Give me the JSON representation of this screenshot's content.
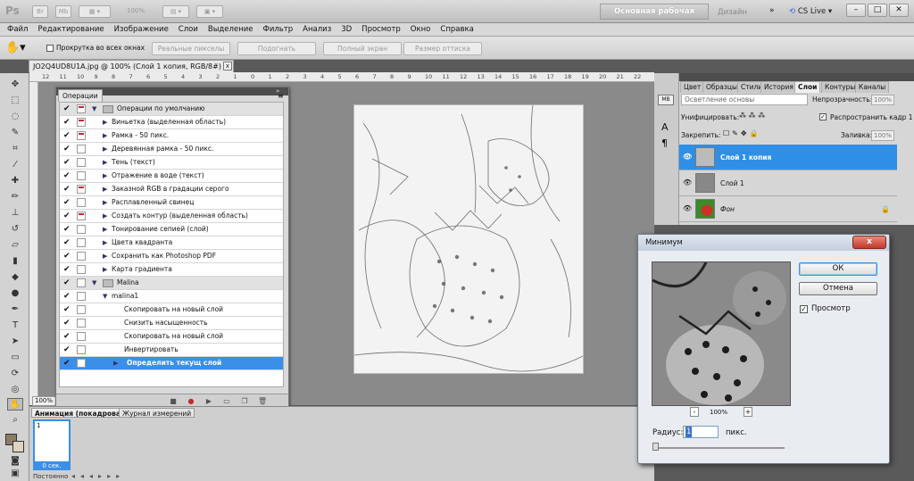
{
  "app": {
    "logo": "Ps",
    "zoom": "100%",
    "workspace_active": "Основная рабочая среда",
    "workspace_other": "Дизайн",
    "cslive": "CS Live",
    "min": "–",
    "max": "□",
    "close": "✕"
  },
  "menu": [
    "Файл",
    "Редактирование",
    "Изображение",
    "Слои",
    "Выделение",
    "Фильтр",
    "Анализ",
    "3D",
    "Просмотр",
    "Окно",
    "Справка"
  ],
  "options": {
    "scroll_all": "Прокрутка во всех окнах",
    "actual_pixels": "Реальные пикселы",
    "fit": "Подогнать",
    "fill_screen": "Полный экран",
    "print_size": "Размер оттиска"
  },
  "document": {
    "tab_title": "JO2Q4UD8U1A.jpg @ 100% (Слой 1 копия, RGB/8#) *",
    "close": "x",
    "status_zoom": "100%",
    "ruler_ticks": [
      "12",
      "11",
      "10",
      "9",
      "8",
      "7",
      "6",
      "5",
      "4",
      "3",
      "2",
      "1",
      "0",
      "1",
      "2",
      "3",
      "4",
      "5",
      "6",
      "7",
      "8",
      "9",
      "10",
      "11",
      "12",
      "13",
      "14",
      "15",
      "16",
      "17",
      "18",
      "19",
      "20",
      "21",
      "22"
    ]
  },
  "actions_panel": {
    "tab": "Операции",
    "rows": [
      {
        "label": "Операции по умолчанию",
        "kind": "set",
        "checked": true,
        "dialog": "red"
      },
      {
        "label": "Виньетка (выделенная область)",
        "kind": "action",
        "checked": true,
        "dialog": "red"
      },
      {
        "label": "Рамка - 50 пикс.",
        "kind": "action",
        "checked": true,
        "dialog": "red"
      },
      {
        "label": "Деревянная рамка - 50 пикс.",
        "kind": "action",
        "checked": true,
        "dialog": "none"
      },
      {
        "label": "Тень (текст)",
        "kind": "action",
        "checked": true,
        "dialog": "none"
      },
      {
        "label": "Отражение в воде (текст)",
        "kind": "action",
        "checked": true,
        "dialog": "none"
      },
      {
        "label": "Заказной RGB в градации серого",
        "kind": "action",
        "checked": true,
        "dialog": "red"
      },
      {
        "label": "Расплавленный свинец",
        "kind": "action",
        "checked": true,
        "dialog": "none"
      },
      {
        "label": "Создать контур (выделенная область)",
        "kind": "action",
        "checked": true,
        "dialog": "red"
      },
      {
        "label": "Тонирование сепией (слой)",
        "kind": "action",
        "checked": true,
        "dialog": "none"
      },
      {
        "label": "Цвета квадранта",
        "kind": "action",
        "checked": true,
        "dialog": "none"
      },
      {
        "label": "Сохранить как Photoshop PDF",
        "kind": "action",
        "checked": true,
        "dialog": "plain"
      },
      {
        "label": "Карта градиента",
        "kind": "action",
        "checked": true,
        "dialog": "none"
      },
      {
        "label": "Malina",
        "kind": "set",
        "checked": true,
        "dialog": "none"
      },
      {
        "label": "malina1",
        "kind": "sub",
        "checked": true,
        "dialog": "none"
      },
      {
        "label": "Скопировать на новый слой",
        "kind": "step",
        "checked": true,
        "dialog": "none"
      },
      {
        "label": "Снизить насыщенность",
        "kind": "step",
        "checked": true,
        "dialog": "none"
      },
      {
        "label": "Скопировать на новый слой",
        "kind": "step",
        "checked": true,
        "dialog": "none"
      },
      {
        "label": "Инвертировать",
        "kind": "step",
        "checked": true,
        "dialog": "none"
      },
      {
        "label": "Определить текущ слой",
        "kind": "step_sel",
        "checked": true,
        "dialog": "none"
      }
    ]
  },
  "timeline": {
    "tab_animation": "Анимация (покадровая)",
    "tab_log": "Журнал измерений",
    "frame_number": "1",
    "frame_time": "0 сек.",
    "loop": "Постоянно"
  },
  "layers_panel": {
    "tabs": [
      "Цвет",
      "Образцы",
      "Стили",
      "История",
      "Слои",
      "Контуры",
      "Каналы"
    ],
    "blend_mode": "Осветление основы",
    "opacity_label": "Непрозрачность:",
    "opacity": "100%",
    "unify_label": "Унифицировать:",
    "propagate_label": "Распространить кадр 1",
    "lock_label": "Закрепить:",
    "fill_label": "Заливка:",
    "fill": "100%",
    "layers": [
      {
        "name": "Слой 1 копия",
        "selected": true
      },
      {
        "name": "Слой 1",
        "selected": false
      },
      {
        "name": "Фон",
        "selected": false
      }
    ]
  },
  "minimum_dialog": {
    "title": "Минимум",
    "ok": "ОК",
    "cancel": "Отмена",
    "preview_label": "Просмотр",
    "preview_checked": true,
    "zoom": "100%",
    "zoom_minus": "-",
    "zoom_plus": "+",
    "radius_label": "Радиус:",
    "radius_value": "1",
    "radius_unit": "пикс.",
    "close": "x"
  },
  "colors": {
    "selection": "#3b8fe8",
    "fg": "#8b7c65",
    "bg": "#e0d4c0"
  }
}
